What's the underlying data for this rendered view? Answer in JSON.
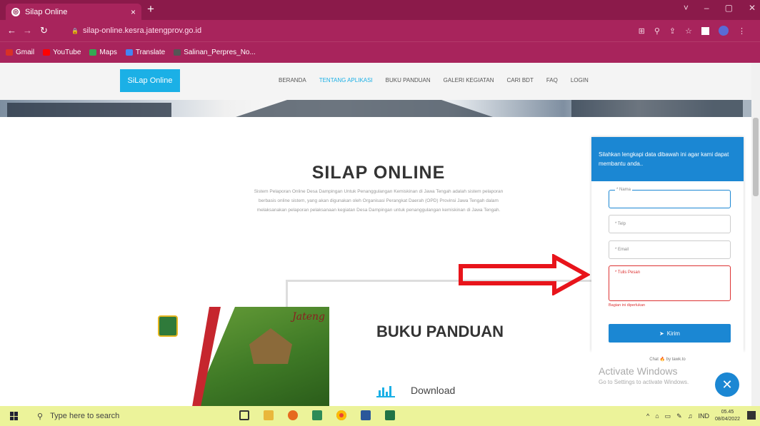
{
  "browser": {
    "tab_title": "Silap Online",
    "tab_close": "×",
    "new_tab": "+",
    "url": "silap-online.kesra.jatengprov.go.id",
    "window_controls": [
      "˅",
      "–",
      "▢",
      "✕"
    ],
    "bookmarks": [
      {
        "label": "Gmail",
        "color": "#d93025"
      },
      {
        "label": "YouTube",
        "color": "#ff0000"
      },
      {
        "label": "Maps",
        "color": "#34a853"
      },
      {
        "label": "Translate",
        "color": "#4285f4"
      },
      {
        "label": "Salinan_Perpres_No...",
        "color": "#555555"
      }
    ]
  },
  "site": {
    "logo": "SiLap Online",
    "nav": [
      "BERANDA",
      "TENTANG APLIKASI",
      "BUKU PANDUAN",
      "GALERI KEGIATAN",
      "CARI BDT",
      "FAQ",
      "LOGIN"
    ],
    "active_nav": "TENTANG APLIKASI",
    "title": "SILAP ONLINE",
    "description": "Sistem Pelaporan Online Desa Dampingan Untuk Penanggulangan Kemiskinan di Jawa Tengah adalah sistem pelaporan berbasis online sistem, yang akan digunakan oleh Organisasi Perangkat Daerah (OPD) Provinsi Jawa Tengah dalam melaksanakan pelaporan pelaksanaan kegiatan Desa Dampingan untuk penanggulangan kemiskinan di Jawa Tengah.",
    "cover_text": "Jateng",
    "section_title": "BUKU PANDUAN",
    "download_label": "Download"
  },
  "form": {
    "header": "Silahkan lengkapi data dibawah ini agar kami dapat membantu anda..",
    "name_label": "* Nama",
    "phone_label": "* Telp",
    "email_label": "* Email",
    "message_label": "* Tulis Pesan",
    "error_text": "Bagian ini diperlukan",
    "submit_label": "Kirim",
    "footer": "Chat 🔥 by tawk.to"
  },
  "watermark": {
    "title": "Activate Windows",
    "subtitle": "Go to Settings to activate Windows."
  },
  "fab_icon": "✕",
  "taskbar": {
    "search_placeholder": "Type here to search",
    "lang": "IND",
    "time": "05.45",
    "date": "08/04/2022"
  },
  "colors": {
    "chrome": "#8b1a4a",
    "accent": "#1bb0e6",
    "widget": "#1b87d3",
    "arrow": "#e8141b",
    "taskbar": "#ecf39a"
  }
}
